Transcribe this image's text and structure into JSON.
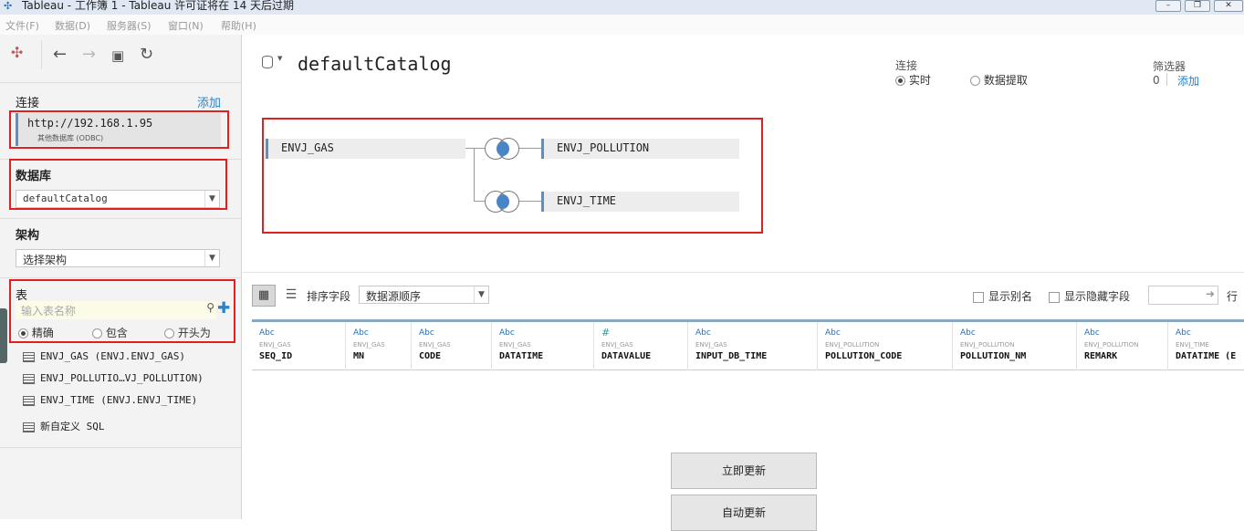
{
  "window": {
    "title": "Tableau - 工作簿 1 - Tableau 许可证将在 14 天后过期",
    "controls": [
      "–",
      "❐",
      "✕"
    ]
  },
  "menu": [
    "文件(F)",
    "数据(D)",
    "服务器(S)",
    "窗口(N)",
    "帮助(H)"
  ],
  "left": {
    "connection": {
      "title": "连接",
      "add_label": "添加",
      "server": "http://192.168.1.95",
      "server_type": "其他数据库 (ODBC)"
    },
    "database": {
      "title": "数据库",
      "selected": "defaultCatalog"
    },
    "schema": {
      "title": "架构",
      "selected": "选择架构"
    },
    "tables": {
      "title": "表",
      "search_placeholder": "输入表名称",
      "match_modes": [
        "精确",
        "包含",
        "开头为"
      ],
      "selected_mode": "精确",
      "items": [
        "ENVJ_GAS (ENVJ.ENVJ_GAS)",
        "ENVJ_POLLUTIO…VJ_POLLUTION)",
        "ENVJ_TIME (ENVJ.ENVJ_TIME)"
      ],
      "custom_sql_label": "新自定义 SQL"
    }
  },
  "main": {
    "datasource_name": "defaultCatalog",
    "connection_mode": {
      "title": "连接",
      "options": [
        "实时",
        "数据提取"
      ],
      "selected": "实时"
    },
    "filters": {
      "title": "筛选器",
      "count": "0",
      "add_label": "添加"
    },
    "join": {
      "left_table": "ENVJ_GAS",
      "right_tables": [
        "ENVJ_POLLUTION",
        "ENVJ_TIME"
      ]
    },
    "grid_toolbar": {
      "sort_label": "排序字段",
      "sort_value": "数据源顺序",
      "show_alias": "显示别名",
      "show_hidden": "显示隐藏字段",
      "rows_label": "行"
    },
    "columns": [
      {
        "type": "Abc",
        "table": "ENVJ_GAS",
        "name": "SEQ_ID"
      },
      {
        "type": "Abc",
        "table": "ENVJ_GAS",
        "name": "MN"
      },
      {
        "type": "Abc",
        "table": "ENVJ_GAS",
        "name": "CODE"
      },
      {
        "type": "Abc",
        "table": "ENVJ_GAS",
        "name": "DATATIME"
      },
      {
        "type": "#",
        "table": "ENVJ_GAS",
        "name": "DATAVALUE"
      },
      {
        "type": "Abc",
        "table": "ENVJ_GAS",
        "name": "INPUT_DB_TIME"
      },
      {
        "type": "Abc",
        "table": "ENVJ_POLLUTION",
        "name": "POLLUTION_CODE"
      },
      {
        "type": "Abc",
        "table": "ENVJ_POLLUTION",
        "name": "POLLUTION_NM"
      },
      {
        "type": "Abc",
        "table": "ENVJ_POLLUTION",
        "name": "REMARK"
      },
      {
        "type": "Abc",
        "table": "ENVJ_TIME",
        "name": "DATATIME (E"
      }
    ],
    "update_now": "立即更新",
    "auto_update": "自动更新"
  }
}
